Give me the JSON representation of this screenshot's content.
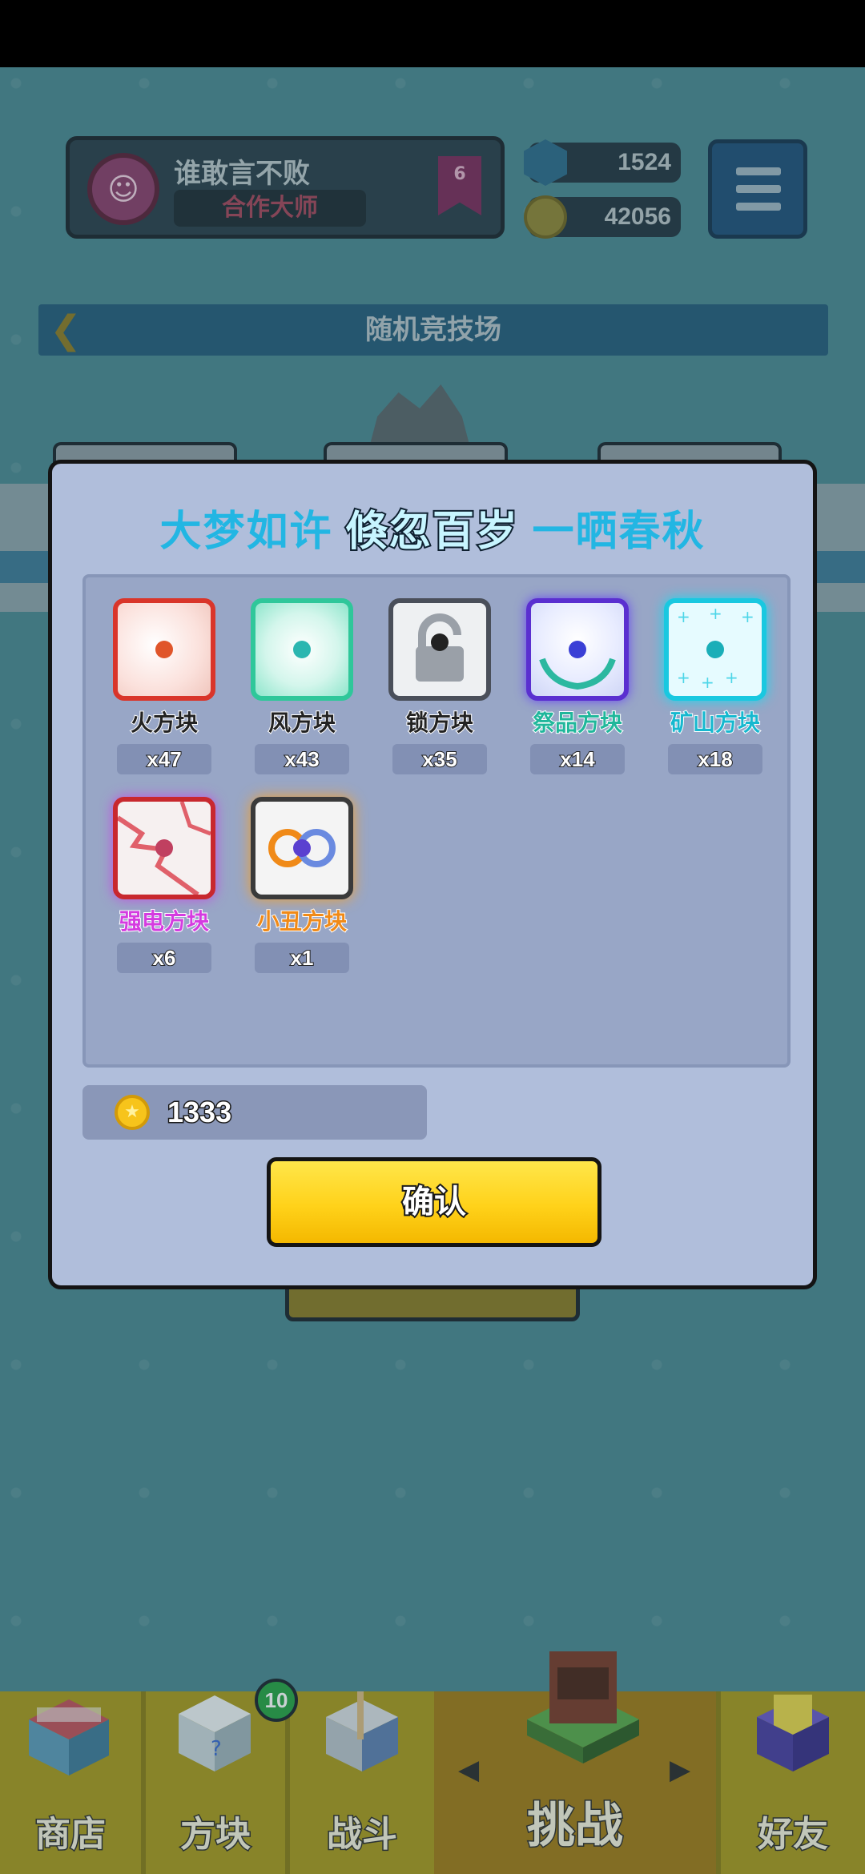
{
  "status_bar": {},
  "background": {
    "profile": {
      "name": "谁敢言不败",
      "title": "合作大师",
      "rank": "6"
    },
    "currencies": {
      "gems": "1524",
      "coins": "42056"
    },
    "arena_title": "随机竞技场"
  },
  "modal": {
    "title": {
      "part1": "大梦如许",
      "part2": "倏忽百岁",
      "part3": "一晒春秋"
    },
    "items": [
      {
        "name": "火方块",
        "count": "x47",
        "color": "#e23a2a",
        "border": "#d9352a",
        "dot": "#e0552a",
        "icon": "fire-block-icon"
      },
      {
        "name": "风方块",
        "count": "x43",
        "color": "#222222",
        "border": "#2fc79a",
        "dot": "#2bb6b0",
        "icon": "wind-block-icon"
      },
      {
        "name": "锁方块",
        "count": "x35",
        "color": "#222222",
        "border": "#4a4f5a",
        "dot": "#222222",
        "icon": "lock-block-icon"
      },
      {
        "name": "祭品方块",
        "count": "x14",
        "color": "#20b79b",
        "border": "#5a2fd0",
        "dot": "#3a3fd6",
        "icon": "offering-block-icon"
      },
      {
        "name": "矿山方块",
        "count": "x18",
        "color": "#16b8cf",
        "border": "#19c8e0",
        "dot": "#1aaeb8",
        "icon": "mine-block-icon"
      },
      {
        "name": "强电方块",
        "count": "x6",
        "color": "#d43ce0",
        "border": "#c8282e",
        "dot": "#c04060",
        "icon": "lightning-block-icon"
      },
      {
        "name": "小丑方块",
        "count": "x1",
        "color": "#f08a18",
        "border": "#3a3a3a",
        "dot": "#5a40d0",
        "icon": "clown-block-icon"
      }
    ],
    "cost": "1333",
    "confirm_label": "确认"
  },
  "nav": {
    "items": [
      {
        "label": "商店",
        "icon": "shop-icon"
      },
      {
        "label": "方块",
        "icon": "block-icon"
      },
      {
        "label": "战斗",
        "icon": "battle-icon"
      },
      {
        "label": "挑战",
        "icon": "challenge-icon"
      },
      {
        "label": "好友",
        "icon": "friend-icon"
      }
    ],
    "block_badge": "10"
  }
}
